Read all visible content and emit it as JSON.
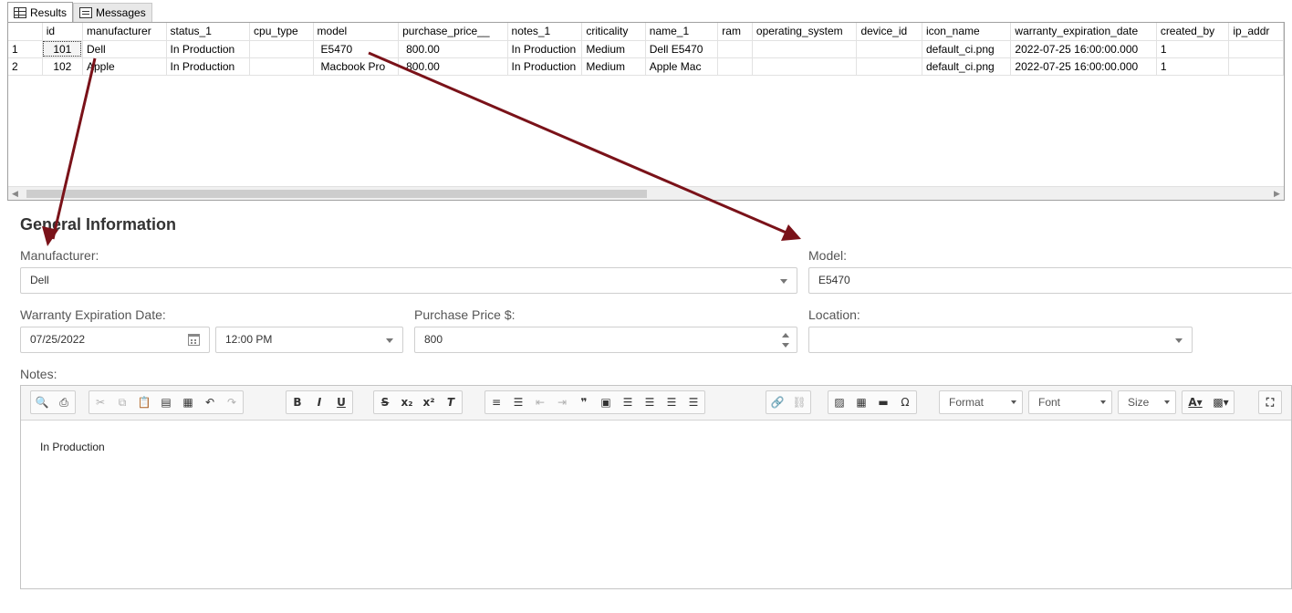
{
  "results": {
    "tabs": [
      {
        "label": "Results",
        "icon": "grid-icon"
      },
      {
        "label": "Messages",
        "icon": "messages-icon"
      }
    ],
    "columns": [
      "",
      "id",
      "manufacturer",
      "status_1",
      "cpu_type",
      "model",
      "purchase_price__",
      "notes_1",
      "criticality",
      "name_1",
      "ram",
      "operating_system",
      "device_id",
      "icon_name",
      "warranty_expiration_date",
      "created_by",
      "ip_addr"
    ],
    "rows": [
      [
        "1",
        "101",
        "Dell",
        "In Production",
        "",
        "E5470",
        "800.00",
        "In Production",
        "Medium",
        "Dell E5470",
        "",
        "",
        "",
        "default_ci.png",
        "2022-07-25 16:00:00.000",
        "1",
        ""
      ],
      [
        "2",
        "102",
        "Apple",
        "In Production",
        "",
        "Macbook Pro",
        "800.00",
        "In Production",
        "Medium",
        "Apple Mac",
        "",
        "",
        "",
        "default_ci.png",
        "2022-07-25 16:00:00.000",
        "1",
        ""
      ]
    ]
  },
  "form": {
    "section_title": "General Information",
    "manufacturer": {
      "label": "Manufacturer:",
      "value": "Dell"
    },
    "model": {
      "label": "Model:",
      "value": "E5470"
    },
    "warranty": {
      "label": "Warranty Expiration Date:",
      "date": "07/25/2022",
      "time": "12:00 PM"
    },
    "purchase_price": {
      "label": "Purchase Price $:",
      "value": "800"
    },
    "location": {
      "label": "Location:",
      "value": ""
    },
    "notes": {
      "label": "Notes:",
      "content": "In Production",
      "toolbar": {
        "format_label": "Format",
        "font_label": "Font",
        "size_label": "Size"
      }
    }
  },
  "colors": {
    "arrow": "#7a1219",
    "grid_border": "#a0a0a0",
    "field_border": "#cfcfcf"
  }
}
